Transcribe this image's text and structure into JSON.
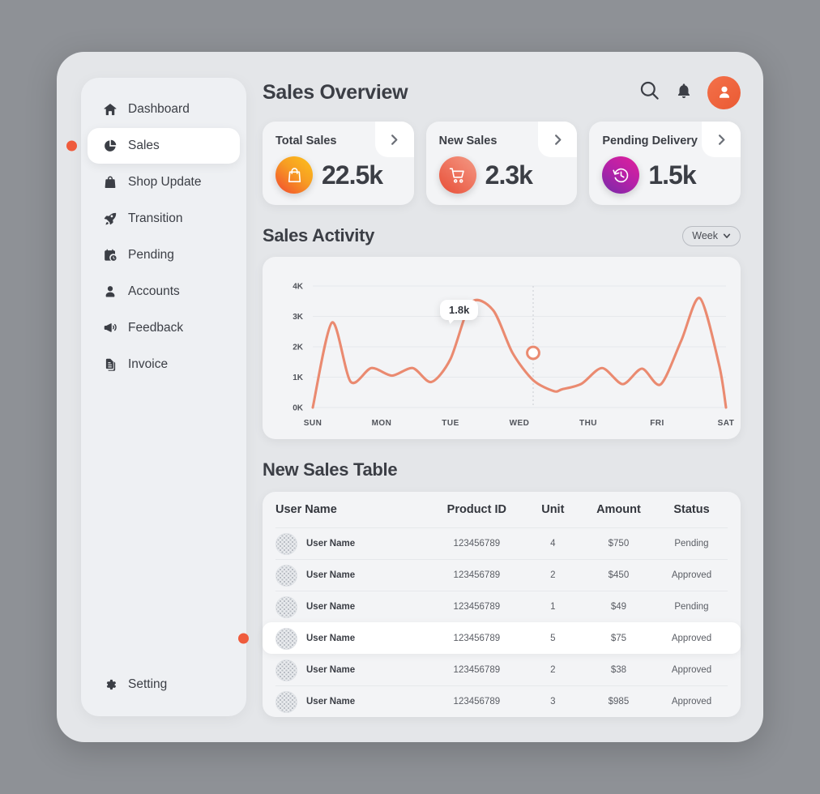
{
  "sidebar": {
    "items": [
      {
        "label": "Dashboard",
        "icon": "home-icon",
        "active": false
      },
      {
        "label": "Sales",
        "icon": "pie-chart-icon",
        "active": true
      },
      {
        "label": "Shop Update",
        "icon": "shopping-bag-icon",
        "active": false
      },
      {
        "label": "Transition",
        "icon": "rocket-icon",
        "active": false
      },
      {
        "label": "Pending",
        "icon": "calendar-clock-icon",
        "active": false
      },
      {
        "label": "Accounts",
        "icon": "user-icon",
        "active": false
      },
      {
        "label": "Feedback",
        "icon": "megaphone-icon",
        "active": false
      },
      {
        "label": "Invoice",
        "icon": "document-icon",
        "active": false
      }
    ],
    "setting": {
      "label": "Setting",
      "icon": "gear-icon"
    }
  },
  "header": {
    "title": "Sales Overview",
    "search_icon": "search-icon",
    "notification_icon": "bell-icon",
    "avatar_icon": "user-avatar-icon"
  },
  "stat_cards": [
    {
      "label": "Total Sales",
      "value": "22.5k",
      "icon": "shopping-bag-icon",
      "accent": "#f79d23"
    },
    {
      "label": "New Sales",
      "value": "2.3k",
      "icon": "shopping-cart-icon",
      "accent": "#e8543d"
    },
    {
      "label": "Pending Delivery",
      "value": "1.5k",
      "icon": "clock-rewind-icon",
      "accent": "#b521a8"
    }
  ],
  "activity": {
    "title": "Sales Activity",
    "range_label": "Week",
    "tooltip_value": "1.8k"
  },
  "chart_data": {
    "type": "line",
    "title": "Sales Activity",
    "xlabel": "",
    "ylabel": "",
    "ylim": [
      0,
      4000
    ],
    "ytick_labels": [
      "0K",
      "1K",
      "2K",
      "3K",
      "4K"
    ],
    "ytick_values": [
      0,
      1000,
      2000,
      3000,
      4000
    ],
    "categories": [
      "SUN",
      "MON",
      "TUE",
      "WED",
      "THU",
      "FRI",
      "SAT"
    ],
    "grid": true,
    "legend": "none",
    "line_color": "#ea8a70",
    "annotation": {
      "label": "1.8k",
      "value": 1800,
      "x_position": "between WED and THU"
    },
    "series": [
      {
        "name": "Sales",
        "x": [
          0.0,
          0.28,
          0.55,
          0.85,
          1.15,
          1.45,
          1.72,
          2.0,
          2.3,
          2.62,
          2.9,
          3.2,
          3.5,
          3.62,
          3.9,
          4.2,
          4.5,
          4.78,
          5.05,
          5.35,
          5.62,
          5.9,
          6.0
        ],
        "values": [
          0,
          2800,
          850,
          1300,
          1050,
          1300,
          840,
          1600,
          3450,
          3200,
          1800,
          900,
          540,
          600,
          780,
          1300,
          770,
          1280,
          760,
          2200,
          3600,
          1400,
          0
        ]
      }
    ]
  },
  "table": {
    "title": "New Sales Table",
    "columns": [
      "User Name",
      "Product ID",
      "Unit",
      "Amount",
      "Status"
    ],
    "rows": [
      {
        "user": "User Name",
        "product_id": "123456789",
        "unit": "4",
        "amount": "$750",
        "status": "Pending",
        "highlight": false
      },
      {
        "user": "User Name",
        "product_id": "123456789",
        "unit": "2",
        "amount": "$450",
        "status": "Approved",
        "highlight": false
      },
      {
        "user": "User Name",
        "product_id": "123456789",
        "unit": "1",
        "amount": "$49",
        "status": "Pending",
        "highlight": false
      },
      {
        "user": "User Name",
        "product_id": "123456789",
        "unit": "5",
        "amount": "$75",
        "status": "Approved",
        "highlight": true
      },
      {
        "user": "User Name",
        "product_id": "123456789",
        "unit": "2",
        "amount": "$38",
        "status": "Approved",
        "highlight": false
      },
      {
        "user": "User Name",
        "product_id": "123456789",
        "unit": "3",
        "amount": "$985",
        "status": "Approved",
        "highlight": false
      }
    ]
  }
}
